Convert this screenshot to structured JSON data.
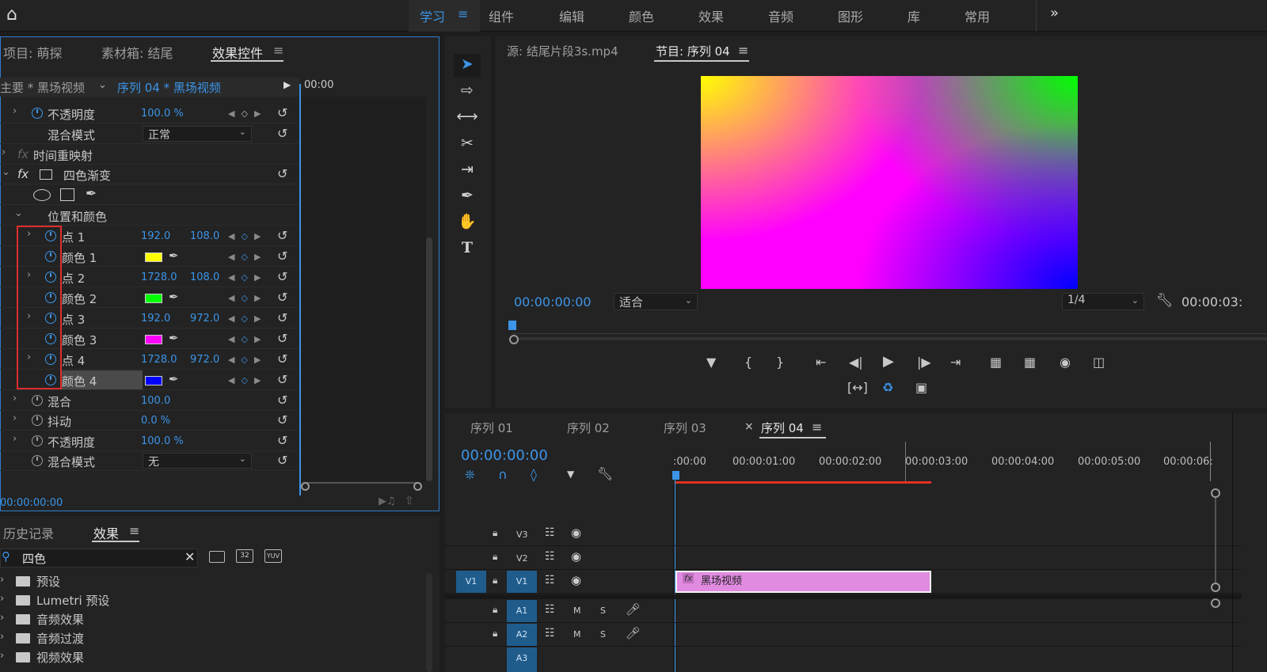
{
  "workspaces": {
    "items": [
      "学习",
      "组件",
      "编辑",
      "颜色",
      "效果",
      "音频",
      "图形",
      "库",
      "常用"
    ],
    "active": "学习",
    "more": "»"
  },
  "effect_panel": {
    "tabs": [
      "项目: 萌探",
      "素材箱: 结尾",
      "效果控件"
    ],
    "clip_header": "主要 * 黑场视频",
    "seq_header": "序列 04 * 黑场视频",
    "timecode_head": "00:00",
    "bottom_timecode": "00:00:00:00",
    "rows": {
      "opacity1_label": "不透明度",
      "opacity1_value": "100.0 %",
      "blend1_label": "混合模式",
      "blend1_value": "正常",
      "timeremap_label": "时间重映射",
      "fourcolor_label": "四色渐变",
      "poscolor_label": "位置和颜色",
      "p1_label": "点 1",
      "p1_x": "192.0",
      "p1_y": "108.0",
      "c1_label": "颜色 1",
      "p2_label": "点 2",
      "p2_x": "1728.0",
      "p2_y": "108.0",
      "c2_label": "颜色 2",
      "p3_label": "点 3",
      "p3_x": "192.0",
      "p3_y": "972.0",
      "c3_label": "颜色 3",
      "p4_label": "点 4",
      "p4_x": "1728.0",
      "p4_y": "972.0",
      "c4_label": "颜色 4",
      "blend_label": "混合",
      "blend_value": "100.0",
      "jitter_label": "抖动",
      "jitter_value": "0.0 %",
      "opacity2_label": "不透明度",
      "opacity2_value": "100.0 %",
      "blend2_label": "混合模式",
      "blend2_value": "无"
    },
    "colors": {
      "c1": "#ffff00",
      "c2": "#00ff00",
      "c3": "#ff00ff",
      "c4": "#0000ff"
    }
  },
  "monitor": {
    "source_tab": "源: 结尾片段3s.mp4",
    "program_tab": "节目: 序列 04",
    "timecode": "00:00:00:00",
    "fit": "适合",
    "resolution": "1/4",
    "duration": "00:00:03:"
  },
  "timeline": {
    "tabs": [
      "序列 01",
      "序列 02",
      "序列 03",
      "序列 04"
    ],
    "close": "×",
    "timecode": "00:00:00:00",
    "ruler": [
      ":00:00",
      "00:00:01:00",
      "00:00:02:00",
      "00:00:03:00",
      "00:00:04:00",
      "00:00:05:00",
      "00:00:06:"
    ],
    "tracks": {
      "v3": "V3",
      "v2": "V2",
      "v1": "V1",
      "src_v1": "V1",
      "a1": "A1",
      "a2": "A2",
      "a3": "A3",
      "m": "M",
      "s": "S"
    },
    "clip_fx": "fx",
    "clip_name": "黑场视频"
  },
  "effects_browser": {
    "tabs": [
      "历史记录",
      "效果"
    ],
    "search_value": "四色",
    "items": [
      "预设",
      "Lumetri 预设",
      "音频效果",
      "音频过渡",
      "视频效果"
    ]
  }
}
